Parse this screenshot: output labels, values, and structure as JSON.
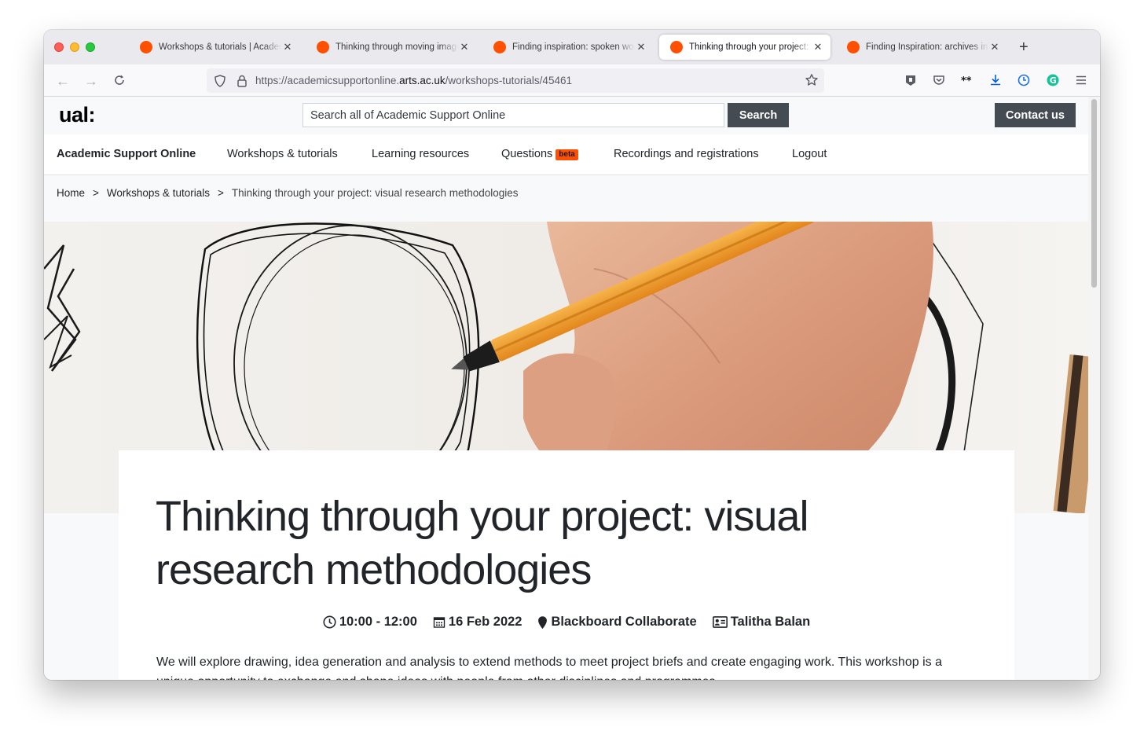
{
  "browser": {
    "tabs": [
      {
        "title": "Workshops & tutorials | Academic Support Online",
        "active": false
      },
      {
        "title": "Thinking through moving image",
        "active": false
      },
      {
        "title": "Finding inspiration: spoken word",
        "active": false
      },
      {
        "title": "Thinking through your project: visual research methodologies",
        "active": true
      },
      {
        "title": "Finding Inspiration: archives in context",
        "active": false
      }
    ],
    "url_prefix": "https://academicsupportonline.",
    "url_domain": "arts.ac.uk",
    "url_path": "/workshops-tutorials/45461"
  },
  "header": {
    "logo": "ual:",
    "search_placeholder": "Search all of Academic Support Online",
    "search_button": "Search",
    "contact_button": "Contact us"
  },
  "nav": {
    "brand": "Academic Support Online",
    "items": [
      "Workshops & tutorials",
      "Learning resources",
      "Questions",
      "Recordings and registrations",
      "Logout"
    ],
    "beta_badge": "beta"
  },
  "breadcrumb": {
    "home": "Home",
    "section": "Workshops & tutorials",
    "current": "Thinking through your project: visual research methodologies",
    "separator": ">"
  },
  "event": {
    "title": "Thinking through your project: visual research methodologies",
    "time": "10:00 - 12:00",
    "date": "16 Feb 2022",
    "location": "Blackboard Collaborate",
    "host": "Talitha Balan",
    "description": "We will explore drawing, idea generation and analysis to extend methods to meet project briefs and create engaging work. This workshop is a unique opportunity to exchange and shape ideas with people from other disciplines and programmes."
  },
  "colors": {
    "brand_orange": "#ff4f00",
    "button_dark": "#444b52"
  }
}
